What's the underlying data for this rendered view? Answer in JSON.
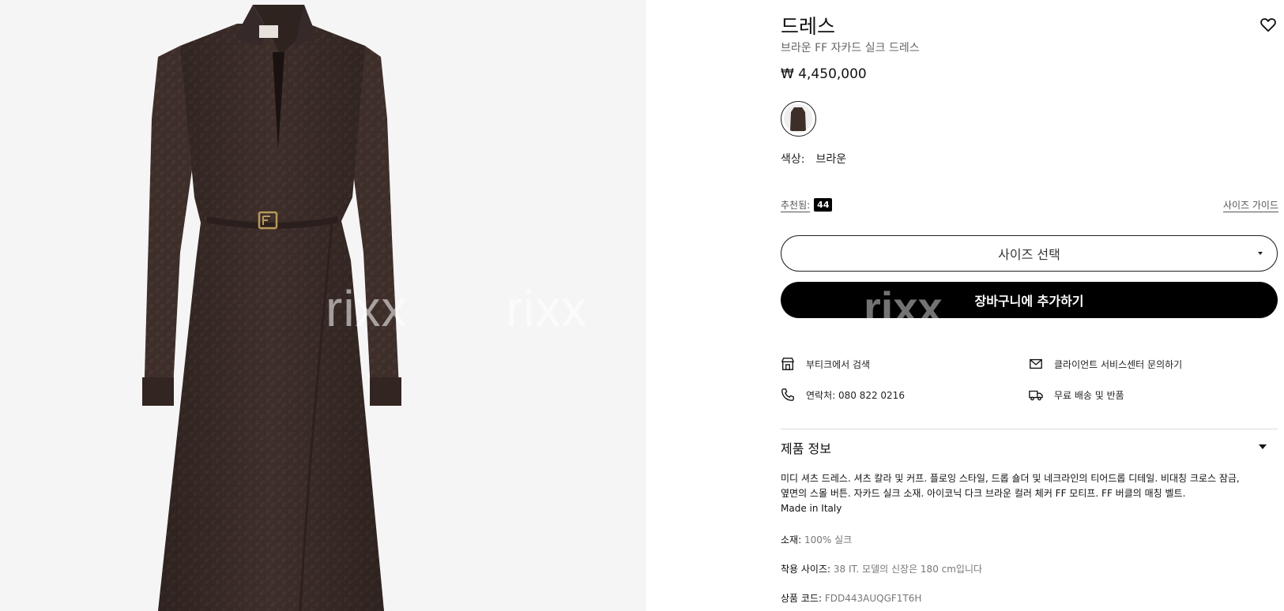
{
  "product": {
    "title": "드레스",
    "subtitle": "브라운 FF 자카드 실크 드레스",
    "price": "₩ 4,450,000"
  },
  "watermark": "rixx",
  "color": {
    "label": "색상:",
    "value": "브라운"
  },
  "size": {
    "recommended_label": "추천됨:",
    "recommended_value": "44",
    "guide_label": "사이즈 가이드",
    "select_placeholder": "사이즈 선택"
  },
  "cart": {
    "add_label": "장바구니에 추가하기"
  },
  "services": {
    "boutique": "부티크에서 검색",
    "client_service": "클라이언트 서비스센터 문의하기",
    "contact": "연락처: 080 822 0216",
    "shipping": "무료 배송 및 반품"
  },
  "product_info": {
    "heading": "제품 정보",
    "description_line1": "미디 셔츠 드레스. 셔츠 칼라 및 커프. 플로잉 스타일, 드롭 숄더 및 네크라인의 티어드롭 디테일. 비대칭 크로스 잠금,",
    "description_line2": "옆면의 스몰 버튼. 자카드 실크 소재. 아이코닉 다크 브라운 컬러 체커 FF 모티프. FF 버클의 매칭 벨트.",
    "description_line3": "Made in Italy",
    "material_label": "소재:",
    "material_value": "100% 실크",
    "fit_label": "착용 사이즈:",
    "fit_value": "38 IT. 모델의 신장은 180 cm입니다",
    "code_label": "상품 코드:",
    "code_value": "FDD443AUQGF1T6H"
  },
  "icons": {
    "wishlist": "heart-icon",
    "boutique": "store-icon",
    "client_service": "mail-icon",
    "contact": "phone-icon",
    "shipping": "truck-icon",
    "size_dropdown": "chevron-down-icon",
    "info_toggle": "caret-down-icon"
  },
  "colors": {
    "dress": "#3d2e2a",
    "background_image": "#f5f5f5",
    "cart_button": "#000000"
  }
}
